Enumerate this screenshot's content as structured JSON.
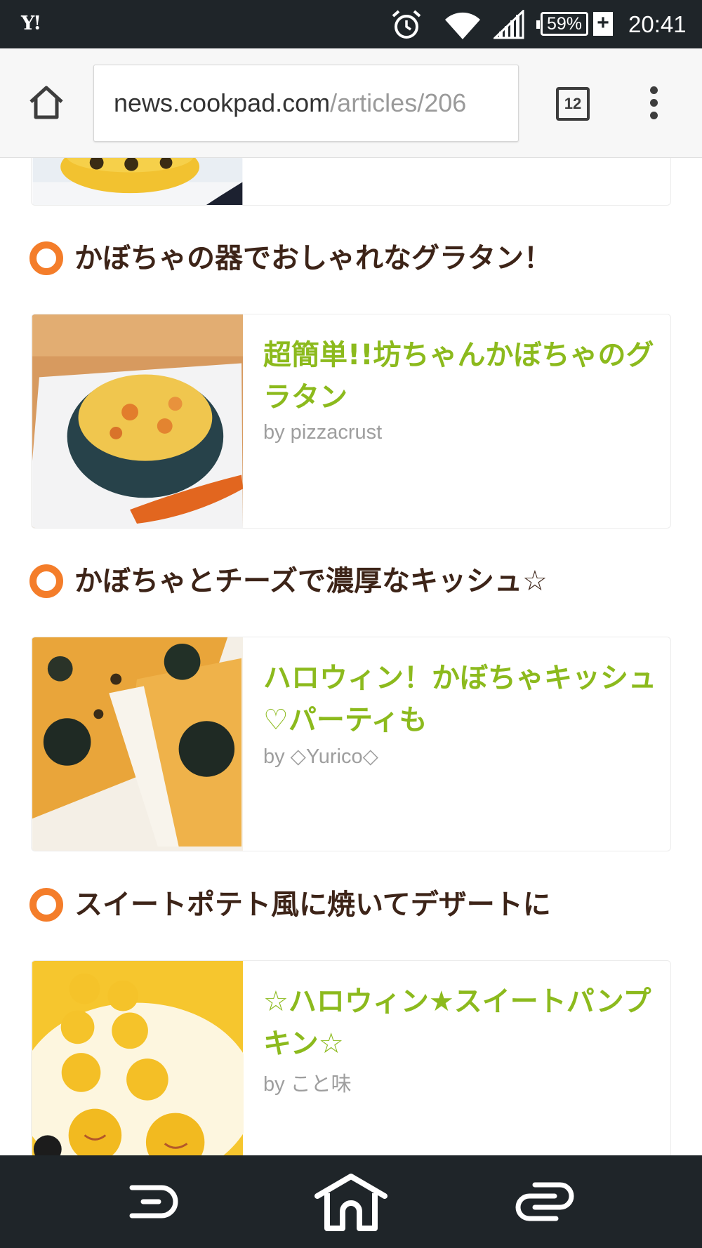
{
  "status_bar": {
    "app_icon": "Y!",
    "icons": [
      "alarm-icon",
      "wifi-icon",
      "signal-icon"
    ],
    "battery": "59%",
    "charging": "+",
    "time": "20:41"
  },
  "browser": {
    "url_host": "news.cookpad.com",
    "url_path": "/articles/206",
    "tab_count": "12"
  },
  "sections": [
    {
      "heading": "かぼちゃの器でおしゃれなグラタン！",
      "recipe_title": "超簡単!!坊ちゃんかぼちゃのグラタン",
      "author": "by pizzacrust",
      "image": "pumpkin-gratin-photo"
    },
    {
      "heading": "かぼちゃとチーズで濃厚なキッシュ☆",
      "recipe_title": "ハロウィン！かぼちゃキッシュ♡パーティも",
      "author": "by ◇Yurico◇",
      "image": "pumpkin-quiche-photo"
    },
    {
      "heading": "スイートポテト風に焼いてデザートに",
      "recipe_title": "☆ハロウィン★スイートパンプキン☆",
      "author": "by こと味",
      "image": "sweet-pumpkin-photo"
    }
  ],
  "nav_bar": [
    "back-icon",
    "home-icon",
    "recents-icon"
  ],
  "colors": {
    "status_bar_bg": "#1f2529",
    "heading_text": "#3d2418",
    "recipe_title": "#8cba1d",
    "section_marker": "#f47d2a",
    "author_text": "#9e9e9e"
  }
}
